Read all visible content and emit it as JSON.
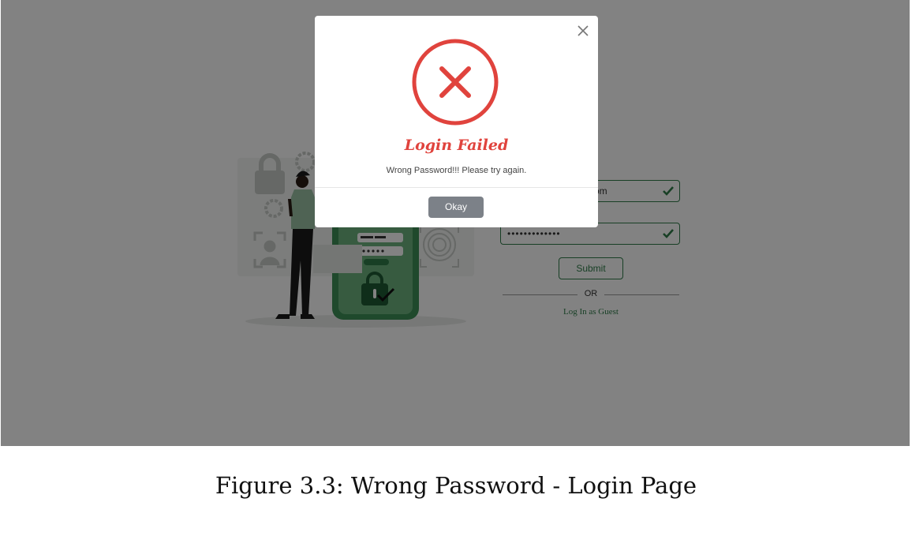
{
  "login_page": {
    "email_visible_text": "om",
    "password_mask": "•••••••••••••",
    "submit_label": "Submit",
    "or_label": "OR",
    "guest_link_label": "Log In as Guest"
  },
  "modal": {
    "title": "Login Failed",
    "message": "Wrong Password!!! Please try again.",
    "okay_label": "Okay",
    "icon": "error-x-icon",
    "close_icon": "close-icon"
  },
  "caption": "Figure 3.3: Wrong Password - Login Page",
  "colors": {
    "error_red": "#e0433d",
    "brand_green": "#2f7d4a",
    "button_gray": "#7c8188",
    "overlay": "rgba(0,0,0,0.49)"
  }
}
